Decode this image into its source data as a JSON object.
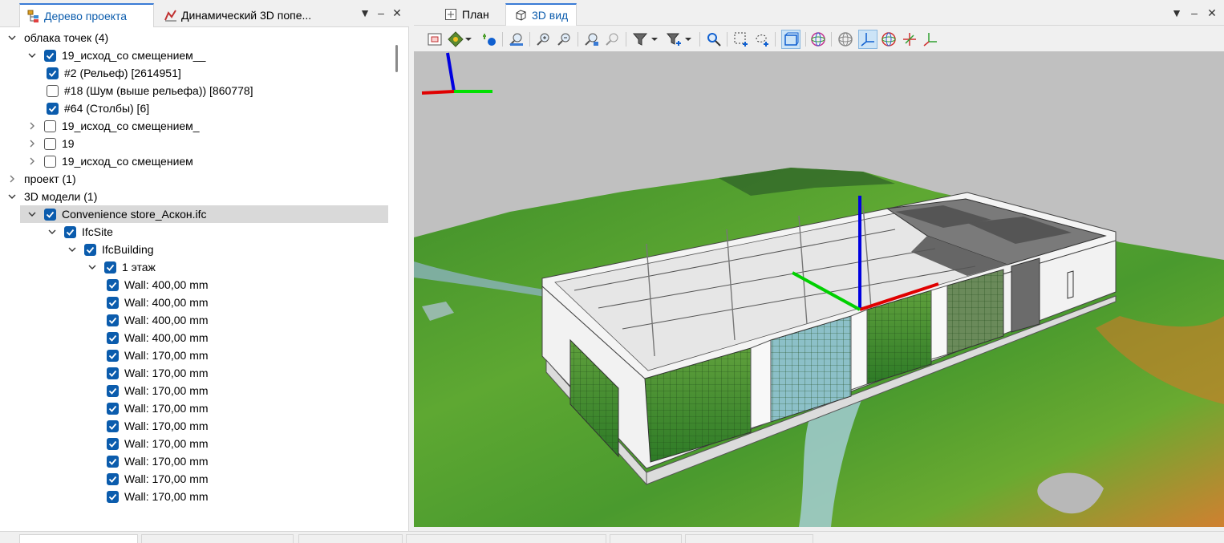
{
  "left_panel": {
    "tabs": [
      {
        "label": "Дерево проекта",
        "active": true
      },
      {
        "label": "Динамический 3D попе...",
        "active": false
      }
    ]
  },
  "tree": {
    "rows": [
      {
        "label": "облака точек (4)",
        "level": 0,
        "expander": "down",
        "checkbox": "none"
      },
      {
        "label": "19_исход_со смещением__",
        "level": 1,
        "expander": "down",
        "checkbox": "on"
      },
      {
        "label": "#2 (Рельеф) [2614951]",
        "level": 2,
        "expander": "none",
        "checkbox": "on"
      },
      {
        "label": "#18 (Шум (выше рельефа)) [860778]",
        "level": 2,
        "expander": "none",
        "checkbox": "off"
      },
      {
        "label": "#64 (Столбы) [6]",
        "level": 2,
        "expander": "none",
        "checkbox": "on"
      },
      {
        "label": "19_исход_со смещением_",
        "level": 1,
        "expander": "right",
        "checkbox": "off"
      },
      {
        "label": "19",
        "level": 1,
        "expander": "right",
        "checkbox": "off"
      },
      {
        "label": "19_исход_со смещением",
        "level": 1,
        "expander": "right",
        "checkbox": "off"
      },
      {
        "label": "проект (1)",
        "level": 0,
        "expander": "right",
        "checkbox": "none"
      },
      {
        "label": "3D модели (1)",
        "level": 0,
        "expander": "down",
        "checkbox": "none"
      },
      {
        "label": "Convenience store_Аскон.ifc",
        "level": 1,
        "expander": "down",
        "checkbox": "on",
        "selected": true
      },
      {
        "label": "IfcSite",
        "level": 2,
        "expander": "down",
        "checkbox": "on"
      },
      {
        "label": "IfcBuilding",
        "level": 3,
        "expander": "down",
        "checkbox": "on"
      },
      {
        "label": "1 этаж",
        "level": 4,
        "expander": "down",
        "checkbox": "on"
      },
      {
        "label": "Wall: 400,00 mm",
        "level": 5,
        "expander": "none",
        "checkbox": "on"
      },
      {
        "label": "Wall: 400,00 mm",
        "level": 5,
        "expander": "none",
        "checkbox": "on"
      },
      {
        "label": "Wall: 400,00 mm",
        "level": 5,
        "expander": "none",
        "checkbox": "on"
      },
      {
        "label": "Wall: 400,00 mm",
        "level": 5,
        "expander": "none",
        "checkbox": "on"
      },
      {
        "label": "Wall: 170,00 mm",
        "level": 5,
        "expander": "none",
        "checkbox": "on"
      },
      {
        "label": "Wall: 170,00 mm",
        "level": 5,
        "expander": "none",
        "checkbox": "on"
      },
      {
        "label": "Wall: 170,00 mm",
        "level": 5,
        "expander": "none",
        "checkbox": "on"
      },
      {
        "label": "Wall: 170,00 mm",
        "level": 5,
        "expander": "none",
        "checkbox": "on"
      },
      {
        "label": "Wall: 170,00 mm",
        "level": 5,
        "expander": "none",
        "checkbox": "on"
      },
      {
        "label": "Wall: 170,00 mm",
        "level": 5,
        "expander": "none",
        "checkbox": "on"
      },
      {
        "label": "Wall: 170,00 mm",
        "level": 5,
        "expander": "none",
        "checkbox": "on"
      },
      {
        "label": "Wall: 170,00 mm",
        "level": 5,
        "expander": "none",
        "checkbox": "on"
      },
      {
        "label": "Wall: 170,00 mm",
        "level": 5,
        "expander": "none",
        "checkbox": "on"
      }
    ]
  },
  "right_panel": {
    "tabs": [
      {
        "label": "План",
        "icon": "plan-icon",
        "active": false
      },
      {
        "label": "3D вид",
        "icon": "cube-icon",
        "active": true
      }
    ]
  },
  "toolbar_icons": [
    "select-box-icon",
    "pan-icon",
    "point-icon",
    "zoom-extents-icon",
    "zoom-in-icon",
    "zoom-out-icon",
    "zoom-window-icon",
    "zoom-prev-icon",
    "filter-icon",
    "filter-add-icon",
    "find-icon",
    "rect-select-icon",
    "lasso-select-icon",
    "bbox-icon",
    "sphere-icon",
    "globe-icon",
    "axis-icon",
    "globe-color-icon",
    "axis-x-icon",
    "axis-y-icon"
  ],
  "colors": {
    "accent": "#0b5cad",
    "axis_x": "#e00000",
    "axis_y": "#00d000",
    "axis_z": "#0000e0",
    "viewport_bg": "#c0c0c0"
  }
}
